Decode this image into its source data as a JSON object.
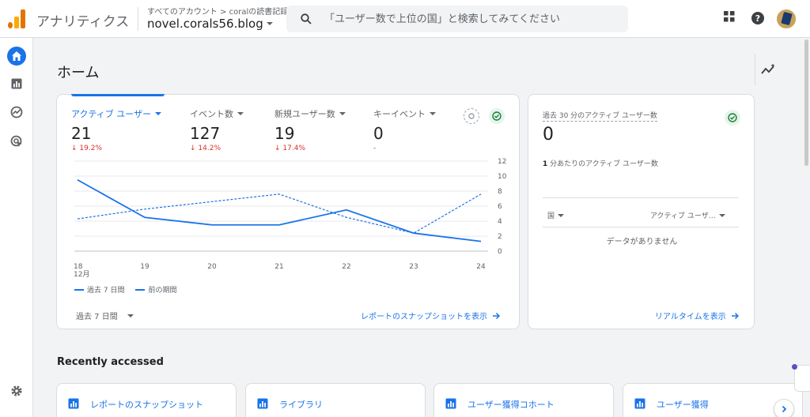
{
  "header": {
    "app_title": "アナリティクス",
    "breadcrumb_account": "すべてのアカウント",
    "breadcrumb_sep": ">",
    "breadcrumb_property": "coralの読書記録",
    "property_name": "novel.corals56.blog",
    "search_placeholder": "「ユーザー数で上位の国」と検索してみてください"
  },
  "page": {
    "title": "ホーム"
  },
  "metrics": [
    {
      "label": "アクティブ ユーザー",
      "value": "21",
      "delta": "↓ 19.2%",
      "active": true
    },
    {
      "label": "イベント数",
      "value": "127",
      "delta": "↓ 14.2%"
    },
    {
      "label": "新規ユーザー数",
      "value": "19",
      "delta": "↓ 17.4%"
    },
    {
      "label": "キーイベント",
      "value": "0",
      "delta": "-"
    }
  ],
  "chart_data": {
    "type": "line",
    "x": [
      "18",
      "19",
      "20",
      "21",
      "22",
      "23",
      "24"
    ],
    "x_sublabel_first": "12月",
    "series": [
      {
        "name": "過去 7 日間",
        "values": [
          9.5,
          4.5,
          3.5,
          3.5,
          5.5,
          2.4,
          1.3
        ],
        "style": "solid"
      },
      {
        "name": "前の期間",
        "values": [
          4.3,
          5.6,
          6.6,
          7.6,
          4.5,
          2.4,
          7.6
        ],
        "style": "dashed"
      }
    ],
    "y_ticks": [
      "12",
      "10",
      "8",
      "6",
      "4",
      "2",
      "0"
    ],
    "ylim": [
      0,
      12
    ],
    "grid": true
  },
  "legend": {
    "current": "過去 7 日間",
    "previous": "前の期間"
  },
  "date_range": "過去 7 日間",
  "snapshot_link": "レポートのスナップショットを表示",
  "realtime": {
    "title": "過去 30 分のアクティブ ユーザー数",
    "value": "0",
    "per_minute_label": "分あたりのアクティブ ユーザー数",
    "per_minute_prefix": "1",
    "col_country": "国",
    "col_users": "アクティブ ユーザ…",
    "empty": "データがありません",
    "link": "リアルタイムを表示"
  },
  "recent": {
    "title": "Recently accessed",
    "items": [
      {
        "label": "レポートのスナップショット"
      },
      {
        "label": "ライブラリ"
      },
      {
        "label": "ユーザー獲得コホート"
      },
      {
        "label": "ユーザー獲得"
      }
    ]
  },
  "colors": {
    "accent": "#1a73e8",
    "negative": "#d93025",
    "logo_orange": "#f9ab00",
    "logo_dark": "#e37400"
  }
}
